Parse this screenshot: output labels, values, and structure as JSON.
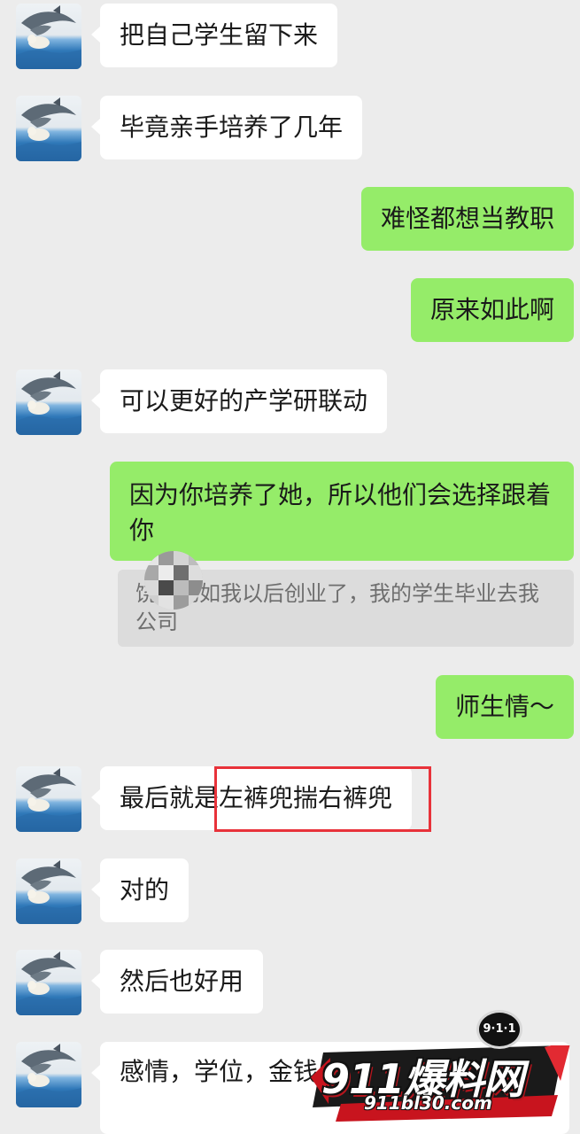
{
  "chat": {
    "messages": [
      {
        "side": "in",
        "text": "把自己学生留下来"
      },
      {
        "side": "in",
        "text": "毕竟亲手培养了几年"
      },
      {
        "side": "out",
        "text": "难怪都想当教职"
      },
      {
        "side": "out",
        "text": "原来如此啊"
      },
      {
        "side": "in",
        "text": "可以更好的产学研联动"
      },
      {
        "side": "out",
        "text": "因为你培养了她，所以他们会选择跟着你"
      },
      {
        "side": "quote",
        "name": "饶",
        "text": "比如我以后创业了，我的学生毕业去我公司"
      },
      {
        "side": "out",
        "text": "师生情～"
      },
      {
        "side": "in",
        "text": "最后就是左裤兜揣右裤兜",
        "highlight": "左裤兜揣右裤兜"
      },
      {
        "side": "in",
        "text": "对的"
      },
      {
        "side": "in",
        "text": "然后也好用"
      },
      {
        "side": "in",
        "text": "感情，学位，金钱，生态里都有"
      }
    ]
  },
  "watermark": {
    "badge": "9·1·1",
    "main": "911爆料网",
    "url": "911bl30.com"
  },
  "colors": {
    "background": "#ececec",
    "incoming_bubble": "#ffffff",
    "outgoing_bubble": "#95ec69",
    "quote_background": "#dcdcdc",
    "highlight_border": "#e8323a"
  }
}
